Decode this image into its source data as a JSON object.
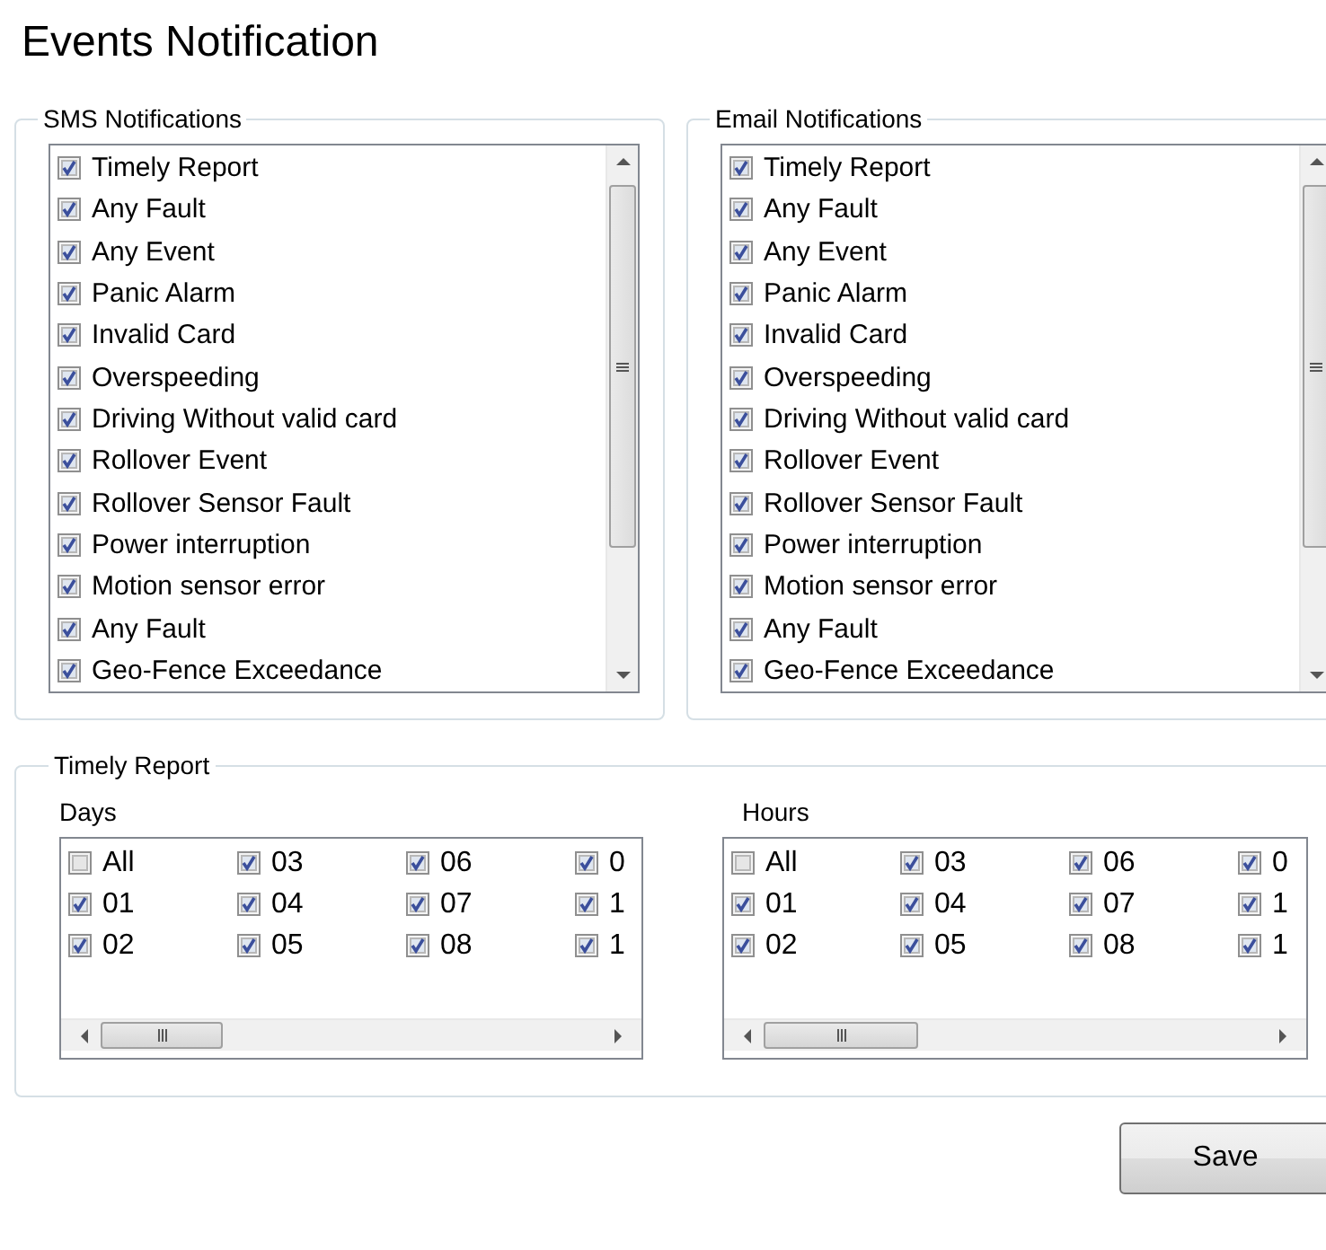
{
  "title": "Events Notification",
  "sms_notifications": {
    "title": "SMS Notifications",
    "items": [
      {
        "label": "Timely Report",
        "checked": true
      },
      {
        "label": "Any Fault",
        "checked": true
      },
      {
        "label": "Any Event",
        "checked": true
      },
      {
        "label": "Panic Alarm",
        "checked": true
      },
      {
        "label": "Invalid Card",
        "checked": true
      },
      {
        "label": "Overspeeding",
        "checked": true
      },
      {
        "label": "Driving Without valid card",
        "checked": true
      },
      {
        "label": "Rollover Event",
        "checked": true
      },
      {
        "label": "Rollover Sensor Fault",
        "checked": true
      },
      {
        "label": "Power interruption",
        "checked": true
      },
      {
        "label": "Motion sensor error",
        "checked": true
      },
      {
        "label": "Any Fault",
        "checked": true
      },
      {
        "label": "Geo-Fence Exceedance",
        "checked": true
      }
    ]
  },
  "email_notifications": {
    "title": "Email Notifications",
    "items": [
      {
        "label": "Timely Report",
        "checked": true
      },
      {
        "label": "Any Fault",
        "checked": true
      },
      {
        "label": "Any Event",
        "checked": true
      },
      {
        "label": "Panic Alarm",
        "checked": true
      },
      {
        "label": "Invalid Card",
        "checked": true
      },
      {
        "label": "Overspeeding",
        "checked": true
      },
      {
        "label": "Driving Without valid card",
        "checked": true
      },
      {
        "label": "Rollover Event",
        "checked": true
      },
      {
        "label": "Rollover Sensor Fault",
        "checked": true
      },
      {
        "label": "Power interruption",
        "checked": true
      },
      {
        "label": "Motion sensor error",
        "checked": true
      },
      {
        "label": "Any Fault",
        "checked": true
      },
      {
        "label": "Geo-Fence Exceedance",
        "checked": true
      }
    ]
  },
  "timely_report": {
    "title": "Timely Report",
    "days": {
      "label": "Days",
      "options": [
        {
          "label": "All",
          "checked": false
        },
        {
          "label": "01",
          "checked": true
        },
        {
          "label": "02",
          "checked": true
        },
        {
          "label": "03",
          "checked": true
        },
        {
          "label": "04",
          "checked": true
        },
        {
          "label": "05",
          "checked": true
        },
        {
          "label": "06",
          "checked": true
        },
        {
          "label": "07",
          "checked": true
        },
        {
          "label": "08",
          "checked": true
        },
        {
          "label": "0",
          "checked": true
        },
        {
          "label": "1",
          "checked": true
        },
        {
          "label": "1",
          "checked": true
        }
      ]
    },
    "hours": {
      "label": "Hours",
      "options": [
        {
          "label": "All",
          "checked": false
        },
        {
          "label": "01",
          "checked": true
        },
        {
          "label": "02",
          "checked": true
        },
        {
          "label": "03",
          "checked": true
        },
        {
          "label": "04",
          "checked": true
        },
        {
          "label": "05",
          "checked": true
        },
        {
          "label": "06",
          "checked": true
        },
        {
          "label": "07",
          "checked": true
        },
        {
          "label": "08",
          "checked": true
        },
        {
          "label": "0",
          "checked": true
        },
        {
          "label": "1",
          "checked": true
        },
        {
          "label": "1",
          "checked": true
        }
      ]
    }
  },
  "buttons": [
    {
      "label": "Save"
    }
  ]
}
